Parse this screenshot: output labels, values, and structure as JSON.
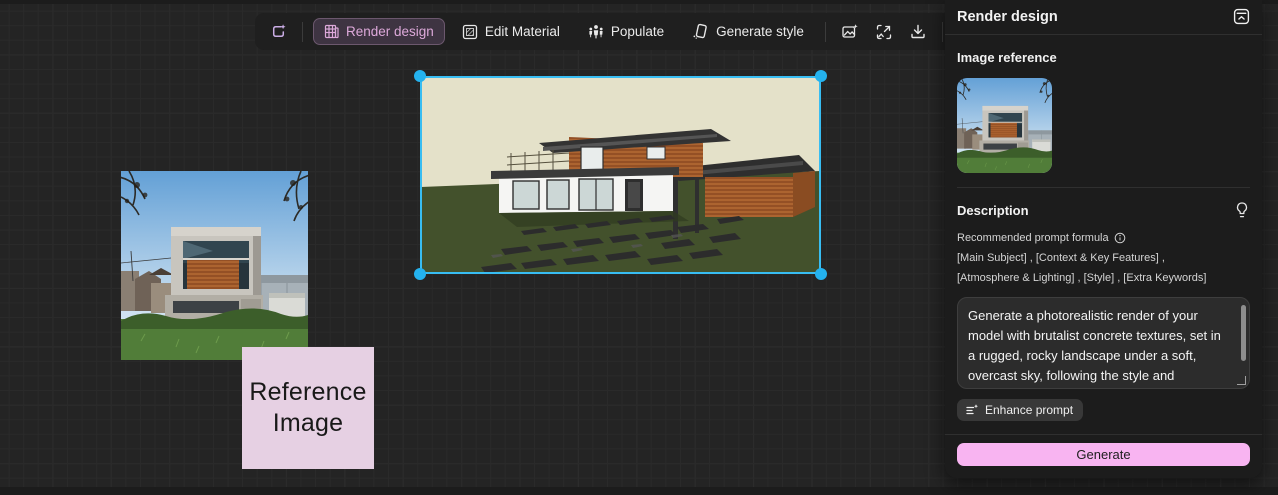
{
  "toolbar": {
    "ai_frame_icon": "frame-sparkle-icon",
    "buttons": [
      {
        "label": "Render design",
        "icon": "building-grid-icon",
        "active": true
      },
      {
        "label": "Edit Material",
        "icon": "material-swatch-icon",
        "active": false
      },
      {
        "label": "Populate",
        "icon": "people-icon",
        "active": false
      },
      {
        "label": "Generate style",
        "icon": "style-card-icon",
        "active": false
      }
    ],
    "icon_buttons": [
      "image-enhance-icon",
      "image-expand-icon",
      "download-icon",
      "focus-center-icon"
    ]
  },
  "canvas": {
    "reference_image_label": "Reference Image",
    "selection_color": "#38bdf2",
    "objects": [
      "reference-photo",
      "model-viewport",
      "reference-image-label-box"
    ]
  },
  "panel": {
    "title": "Render design",
    "collapse_icon": "collapse-panel-icon",
    "image_reference_label": "Image reference",
    "description": {
      "label": "Description",
      "hint_icon": "lightbulb-icon",
      "formula_heading": "Recommended prompt formula",
      "formula_info_icon": "info-icon",
      "formula_lines": [
        "[Main Subject] , [Context & Key Features] ,",
        "[Atmosphere & Lighting] , [Style] , [Extra Keywords]"
      ],
      "prompt_text": "Generate a photorealistic render of your model with brutalist concrete textures, set in a rugged, rocky landscape under a soft, overcast sky, following the style and",
      "enhance_button_label": "Enhance prompt"
    },
    "generate_button_label": "Generate"
  },
  "colors": {
    "accent_pink": "#f8b4f1",
    "active_tool_text": "#dda9da",
    "selection_cyan": "#38bdf2",
    "canvas_bg": "#242424",
    "panel_bg": "#1c1c1c"
  }
}
